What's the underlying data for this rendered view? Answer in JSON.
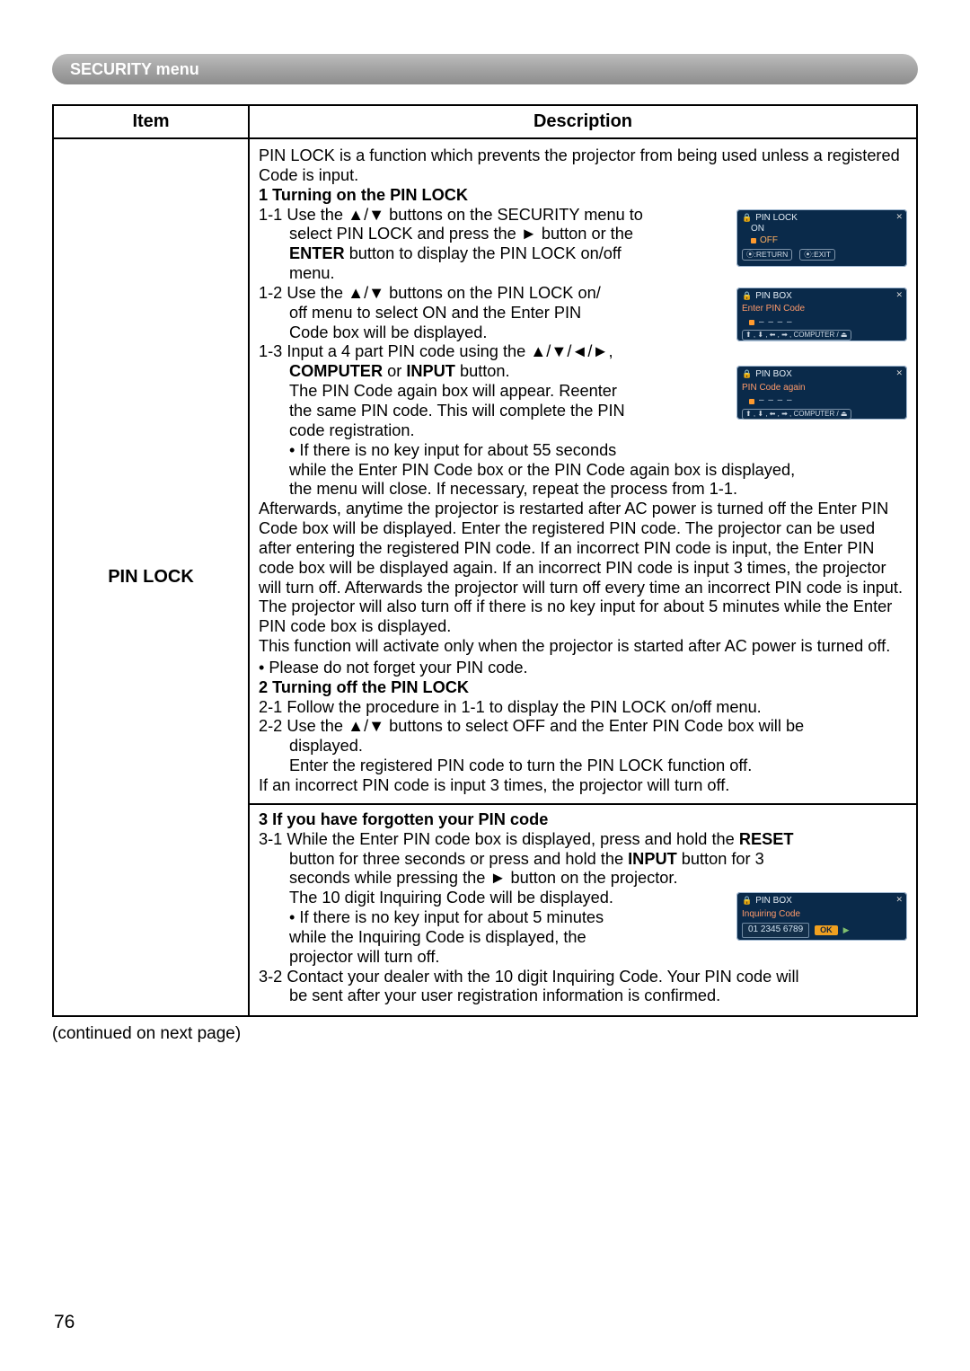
{
  "menu_title": "SECURITY menu",
  "headers": {
    "item": "Item",
    "description": "Description"
  },
  "row_label": "PIN LOCK",
  "continued": "(continued on next page)",
  "page_number": "76",
  "intro": "PIN LOCK is a function which prevents the projector from being used unless a registered Code is input.",
  "sec1": {
    "title": "1 Turning on the PIN LOCK",
    "s11a": "1-1 Use the ▲/▼ buttons on the SECURITY menu to",
    "s11b": "select PIN LOCK and press the ► button or the",
    "s11c_pre": "ENTER",
    "s11c_post": " button to display the PIN LOCK on/off",
    "s11d": "menu.",
    "s12a": "1-2 Use the ▲/▼ buttons on the PIN LOCK on/",
    "s12b": "off menu to select ON and the Enter PIN",
    "s12c": "Code box will be displayed.",
    "s13a": "1-3 Input a 4 part PIN code using the ▲/▼/◄/►,",
    "s13b_pre": "COMPUTER",
    "s13b_mid": " or ",
    "s13b_post": "INPUT",
    "s13b_end": " button.",
    "s13c": "The PIN Code again box will appear. Reenter",
    "s13d": "the same PIN code. This will complete the PIN",
    "s13e": "code registration.",
    "bul1a": "• If there is no key input for about 55 seconds",
    "bul1b": "while the Enter PIN Code box or the PIN Code again box is displayed,",
    "bul1c": "the menu will close. If necessary, repeat the process from 1-1.",
    "para1": "Afterwards, anytime the projector is restarted after AC power  is turned off the Enter PIN Code box will be displayed. Enter the registered PIN code. The projector can be used after entering the registered PIN code. If an incorrect PIN code is input, the Enter PIN code box will be displayed again. If an incorrect PIN code is input 3 times, the projector will turn off. Afterwards the projector will turn off every time an incorrect PIN code is input. The projector will also turn off if there is no key input for about 5 minutes while the Enter PIN code box is displayed.",
    "para2": "This function will activate only when the projector is started after AC power is turned off.",
    "bul2": "• Please do not forget your PIN code."
  },
  "sec2": {
    "title": "2 Turning off the PIN LOCK",
    "s21": "2-1 Follow the procedure in 1-1 to display the PIN LOCK on/off menu.",
    "s22a": "2-2 Use the ▲/▼ buttons to select OFF and the Enter PIN Code box will be",
    "s22b": "displayed.",
    "s22c": "Enter the registered PIN code to turn the PIN LOCK function off.",
    "foot": "If an incorrect PIN code is input 3 times, the projector will turn off."
  },
  "sec3": {
    "title": "3 If you have forgotten your PIN code",
    "s31a_pre": "3-1 While the Enter PIN code box is displayed, press and hold the ",
    "s31a_b": "RESET",
    "s31b_pre": "button for three seconds or press and hold the ",
    "s31b_b": "INPUT",
    "s31b_post": " button for 3",
    "s31c": "seconds while pressing the ► button on the projector.",
    "s31d": "The 10 digit Inquiring Code will be displayed.",
    "bul3a": "• If there is no key input for about 5 minutes",
    "bul3b": "while the Inquiring Code is displayed, the",
    "bul3c": "projector will turn off.",
    "s32a": "3-2 Contact your dealer with the 10 digit Inquiring Code. Your PIN code will",
    "s32b": "be sent after your user registration information is confirmed."
  },
  "osd": {
    "pinlock_title": "PIN LOCK",
    "on": "ON",
    "off": "OFF",
    "return": "⦿:RETURN",
    "exit": "⦿:EXIT",
    "pinbox_title": "PIN BOX",
    "enter_label": "Enter PIN Code",
    "again_label": "PIN Code again",
    "dashes": "– – – –",
    "dir_btns": "⬆ , ⬇ , ⬅ , ➡ , COMPUTER / ⏏",
    "inq_label": "Inquiring Code",
    "inq_code": "01 2345 6789",
    "ok": "OK"
  }
}
